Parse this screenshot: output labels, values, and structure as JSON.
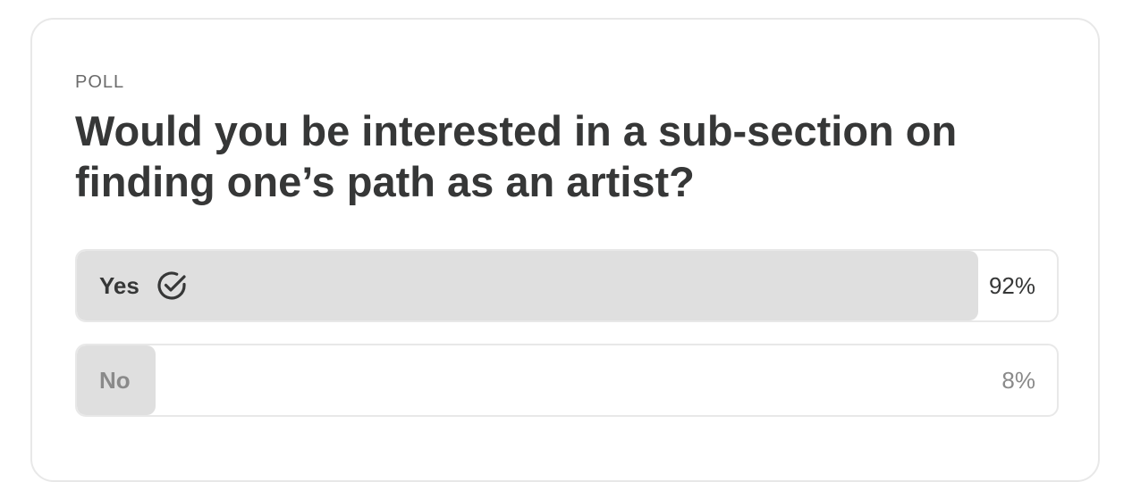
{
  "poll": {
    "label": "POLL",
    "question": "Would you be interested in a sub-section on finding one’s path as an artist?",
    "options": [
      {
        "label": "Yes",
        "percent_text": "92%",
        "percent": 0.92,
        "selected": true,
        "icon": "check-circle-icon"
      },
      {
        "label": "No",
        "percent_text": "8%",
        "percent": 0.08,
        "selected": false
      }
    ]
  },
  "colors": {
    "text": "#363737",
    "muted": "#8a8a8a",
    "bar_fill": "#dfdfdf",
    "border": "#e8e8e8"
  }
}
